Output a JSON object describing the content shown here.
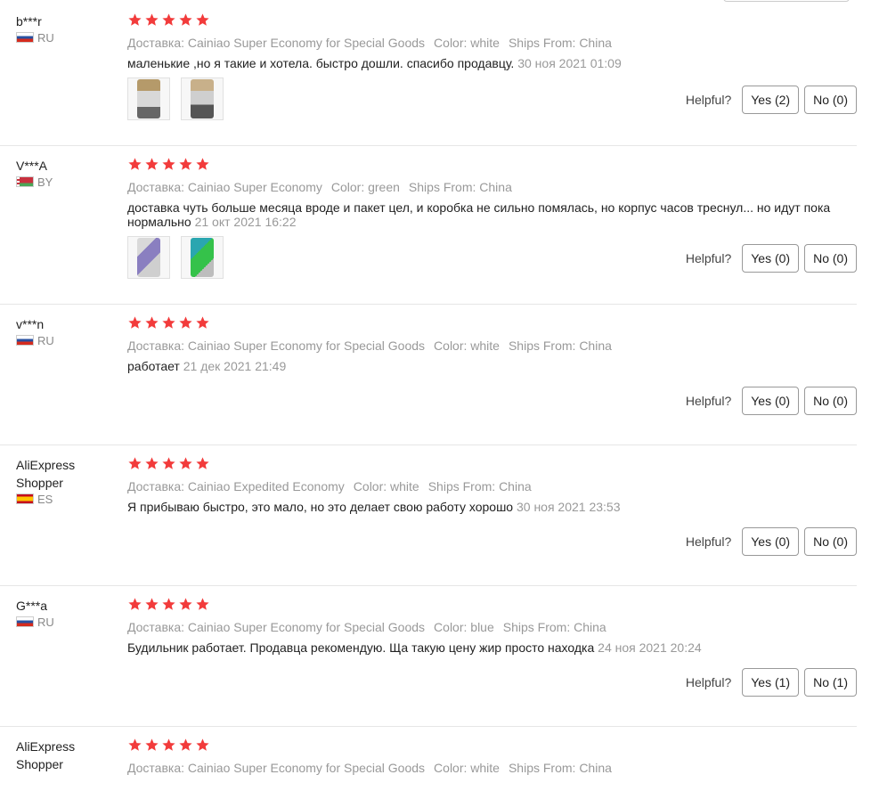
{
  "helpful_label": "Helpful?",
  "reviews": [
    {
      "user": "b***r",
      "country": "RU",
      "rating": 5,
      "shipping": "Доставка: Cainiao Super Economy for Special Goods",
      "color": "Color: white",
      "ships_from": "Ships From: China",
      "text": "маленькие ,но я такие и хотела. быстро дошли. спасибо продавцу.",
      "date": "30 ноя 2021 01:09",
      "yes": "Yes (2)",
      "no": "No (0)",
      "photos": 2
    },
    {
      "user": "V***A",
      "country": "BY",
      "rating": 5,
      "shipping": "Доставка: Cainiao Super Economy",
      "color": "Color: green",
      "ships_from": "Ships From: China",
      "text": "доставка чуть больше месяца вроде и пакет цел, и коробка не сильно помялась, но корпус часов треснул... но идут пока нормально",
      "date": "21 окт 2021 16:22",
      "yes": "Yes (0)",
      "no": "No (0)",
      "photos": 2
    },
    {
      "user": "v***n",
      "country": "RU",
      "rating": 5,
      "shipping": "Доставка: Cainiao Super Economy for Special Goods",
      "color": "Color: white",
      "ships_from": "Ships From: China",
      "text": "работает",
      "date": "21 дек 2021 21:49",
      "yes": "Yes (0)",
      "no": "No (0)",
      "photos": 0
    },
    {
      "user": "AliExpress Shopper",
      "country": "ES",
      "rating": 5,
      "shipping": "Доставка: Cainiao Expedited Economy",
      "color": "Color: white",
      "ships_from": "Ships From: China",
      "text": "Я прибываю быстро, это мало, но это делает свою работу хорошо",
      "date": "30 ноя 2021 23:53",
      "yes": "Yes (0)",
      "no": "No (0)",
      "photos": 0
    },
    {
      "user": "G***a",
      "country": "RU",
      "rating": 5,
      "shipping": "Доставка: Cainiao Super Economy for Special Goods",
      "color": "Color: blue",
      "ships_from": "Ships From: China",
      "text": "Будильник работает. Продавца рекомендую. Ща такую цену жир просто находка",
      "date": "24 ноя 2021 20:24",
      "yes": "Yes (1)",
      "no": "No (1)",
      "photos": 0
    },
    {
      "user": "AliExpress Shopper",
      "country": "",
      "rating": 5,
      "shipping": "Доставка: Cainiao Super Economy for Special Goods",
      "color": "Color: white",
      "ships_from": "Ships From: China",
      "text": "",
      "date": "",
      "yes": "",
      "no": "",
      "photos": 0
    }
  ],
  "colors": {
    "star": "#f23b3b",
    "meta": "#999999",
    "border": "#e6e6e6"
  }
}
